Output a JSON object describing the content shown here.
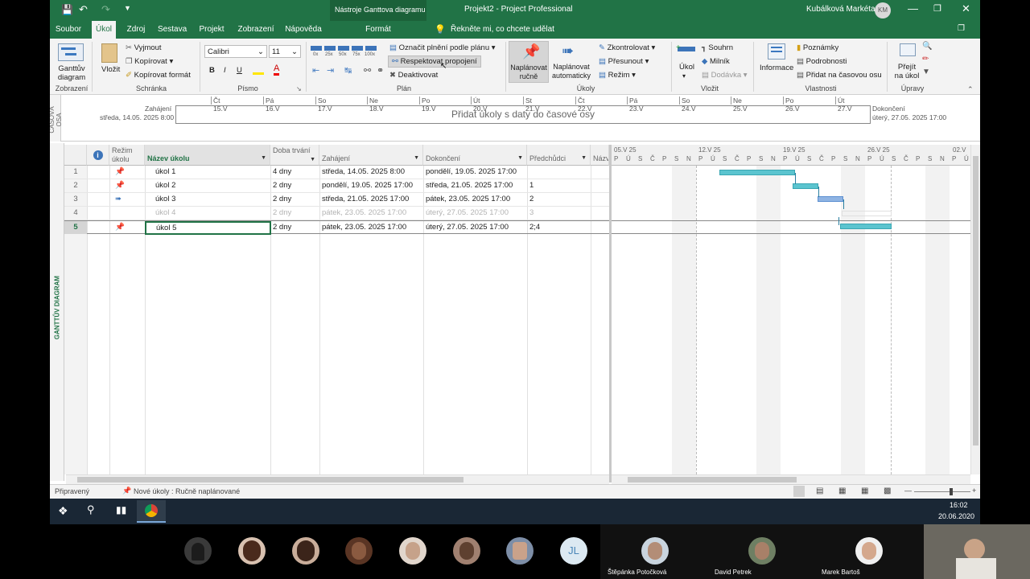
{
  "titlebar": {
    "context_tab": "Nástroje Ganttova diagramu",
    "title": "Projekt2 - Project Professional",
    "user": "Kubálková Markéta",
    "user_initials": "KM"
  },
  "tabs": [
    "Soubor",
    "Úkol",
    "Zdroj",
    "Sestava",
    "Projekt",
    "Zobrazení",
    "Nápověda",
    "Formát"
  ],
  "tell_me": "Řekněte mi, co chcete udělat",
  "ribbon": {
    "gantt_label": "Ganttův diagram",
    "view_group": "Zobrazení",
    "paste": "Vložit",
    "cut": "Vyjmout",
    "copy": "Kopírovat",
    "format_painter": "Kopírovat formát",
    "clipboard_group": "Schránka",
    "font_name": "Calibri",
    "font_size": "11",
    "bold": "B",
    "italic": "I",
    "underline": "U",
    "font_group": "Písmo",
    "pct": [
      "0x",
      "25x",
      "50x",
      "75x",
      "100x"
    ],
    "mark_on_track": "Označit plnění podle plánu",
    "respect_links": "Respektovat propojení",
    "deactivate": "Deaktivovat",
    "plan_group": "Plán",
    "manual": "Naplánovat ručně",
    "auto": "Naplánovat automaticky",
    "inspect": "Zkontrolovat",
    "move": "Přesunout",
    "mode": "Režim",
    "tasks_group": "Úkoly",
    "task": "Úkol",
    "summary": "Souhrn",
    "milestone": "Milník",
    "deliverable": "Dodávka",
    "insert_group": "Vložit",
    "info": "Informace",
    "notes": "Poznámky",
    "details": "Podrobnosti",
    "add_timeline": "Přidat na časovou osu",
    "props_group": "Vlastnosti",
    "goto": "Přejít na úkol",
    "edit_group": "Úpravy"
  },
  "timeline": {
    "side_label": "ČASOVÁ OSA",
    "start_label": "Zahájení",
    "start_date": "středa, 14.05. 2025 8:00",
    "end_label": "Dokončení",
    "end_date": "úterý, 27.05. 2025 17:00",
    "placeholder": "Přidat úkoly s daty do časové osy",
    "ticks": [
      "Čt 15.V",
      "Pá 16.V",
      "So 17.V",
      "Ne 18.V",
      "Po 19.V",
      "Út 20.V",
      "St 21.V",
      "Čt 22.V",
      "Pá 23.V",
      "So 24.V",
      "Ne 25.V",
      "Po 26.V",
      "Út 27.V"
    ]
  },
  "grid": {
    "side_label": "GANTTŮV DIAGRAM",
    "headers": {
      "info": "i",
      "mode": "Režim úkolu",
      "name": "Název úkolu",
      "duration": "Doba trvání",
      "start": "Zahájení",
      "finish": "Dokončení",
      "pred": "Předchůdci",
      "extra": "Názv"
    },
    "rows": [
      {
        "id": "1",
        "name": "úkol 1",
        "duration": "4 dny",
        "start": "středa, 14.05. 2025 8:00",
        "finish": "pondělí, 19.05. 2025 17:00",
        "pred": ""
      },
      {
        "id": "2",
        "name": "úkol 2",
        "duration": "2 dny",
        "start": "pondělí, 19.05. 2025 17:00",
        "finish": "středa, 21.05. 2025 17:00",
        "pred": "1"
      },
      {
        "id": "3",
        "name": "úkol 3",
        "duration": "2 dny",
        "start": "středa, 21.05. 2025 17:00",
        "finish": "pátek, 23.05. 2025 17:00",
        "pred": "2"
      },
      {
        "id": "4",
        "name": "úkol 4",
        "duration": "2 dny",
        "start": "pátek, 23.05. 2025 17:00",
        "finish": "úterý, 27.05. 2025 17:00",
        "pred": "3"
      },
      {
        "id": "5",
        "name": "úkol 5",
        "duration": "2 dny",
        "start": "pátek, 23.05. 2025 17:00",
        "finish": "úterý, 27.05. 2025 17:00",
        "pred": "2;4"
      }
    ]
  },
  "gantt": {
    "weeks": [
      "05.V 25",
      "12.V 25",
      "19.V 25",
      "26.V 25",
      "02.V"
    ],
    "days": [
      "P",
      "Ú",
      "S",
      "Č",
      "P",
      "S",
      "N"
    ]
  },
  "statusbar": {
    "ready": "Připravený",
    "new_tasks": "Nové úkoly : Ručně naplánované"
  },
  "taskbar": {
    "time": "16:02",
    "date": "20.06.2020"
  },
  "meeting": {
    "avatar_initials": "JL",
    "names": [
      "Štěpánka Potočková",
      "David Petrek",
      "Marek Bartoš"
    ]
  }
}
